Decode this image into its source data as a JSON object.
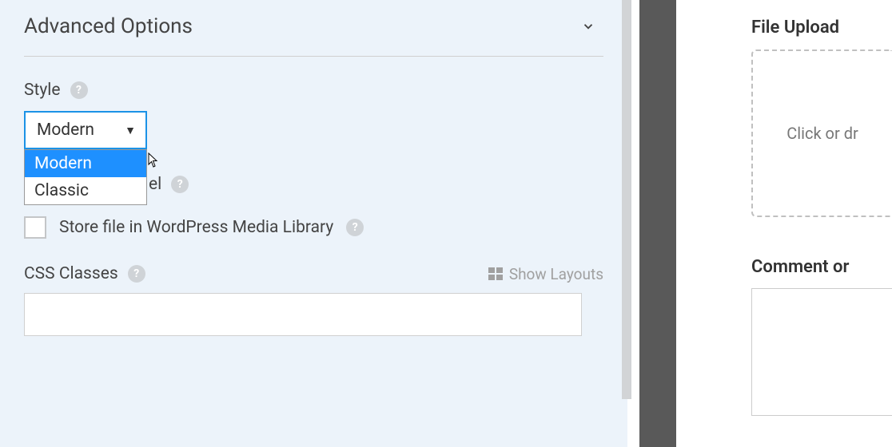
{
  "section": {
    "title": "Advanced Options"
  },
  "style": {
    "label": "Style",
    "selected": "Modern",
    "options": [
      "Modern",
      "Classic"
    ]
  },
  "hideLabel": {
    "fragment": "el"
  },
  "storeFile": {
    "label": "Store file in WordPress Media Library",
    "checked": false
  },
  "cssClasses": {
    "label": "CSS Classes",
    "value": "",
    "showLayouts": "Show Layouts"
  },
  "right": {
    "fileUpload": {
      "title": "File Upload",
      "hint": "Click or dr"
    },
    "comment": {
      "label": "Comment or "
    }
  }
}
